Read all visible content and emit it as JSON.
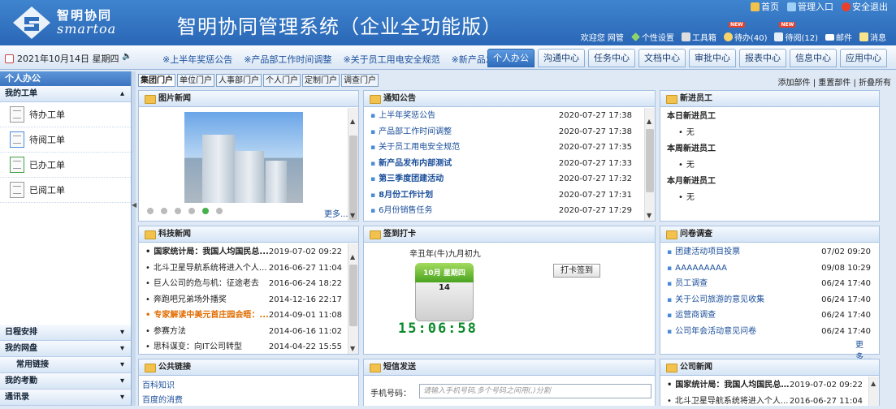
{
  "header": {
    "logo_cn": "智明协同",
    "logo_en": "smartoa",
    "title": "智明协同管理系统（企业全功能版）",
    "toplinks": [
      {
        "label": "首页",
        "icon": "home-icon"
      },
      {
        "label": "管理入口",
        "icon": "admin-icon"
      },
      {
        "label": "安全退出",
        "icon": "power-icon"
      }
    ],
    "userbar": [
      {
        "label": "欢迎您 网管",
        "icon": ""
      },
      {
        "label": "个性设置",
        "icon": "diamond-icon"
      },
      {
        "label": "工具箱",
        "icon": "wrench-icon"
      },
      {
        "label": "待办(40)",
        "icon": "clock-icon",
        "badge": "NEW"
      },
      {
        "label": "待阅(12)",
        "icon": "doc-icon",
        "badge": "NEW"
      },
      {
        "label": "邮件",
        "icon": "mail-icon"
      },
      {
        "label": "消息",
        "icon": "message-icon"
      }
    ]
  },
  "navbar": {
    "date": "2021年10月14日 星期四",
    "marquee": [
      "※上半年奖惩公告",
      "※产品部工作时间调整",
      "※关于员工用电安全规范",
      "※新产品发布内"
    ],
    "tabs": [
      "个人办公",
      "沟通中心",
      "任务中心",
      "文档中心",
      "审批中心",
      "报表中心",
      "信息中心",
      "应用中心"
    ],
    "active_tab": 0
  },
  "sidebar": {
    "head": "个人办公",
    "section": "我的工单",
    "items": [
      "待办工单",
      "待阅工单",
      "已办工单",
      "已阅工单"
    ],
    "bottom": [
      "日程安排",
      "我的网盘",
      "常用链接",
      "我的考勤",
      "通讯录"
    ]
  },
  "subtabs": [
    "集团门户",
    "单位门户",
    "人事部门户",
    "个人门户",
    "定制门户",
    "调查门户"
  ],
  "right_links": "添加部件 | 重置部件 | 折叠所有",
  "panels": {
    "photo_news": {
      "title": "图片新闻",
      "more": "更多..."
    },
    "notice": {
      "title": "通知公告",
      "rows": [
        {
          "t": "上半年奖惩公告",
          "d": "2020-07-27 17:38",
          "style": "blue"
        },
        {
          "t": "产品部工作时间调整",
          "d": "2020-07-27 17:38",
          "style": "blue"
        },
        {
          "t": "关于员工用电安全规范",
          "d": "2020-07-27 17:35",
          "style": "blue"
        },
        {
          "t": "新产品发布内部测试",
          "d": "2020-07-27 17:33",
          "style": "blue bold"
        },
        {
          "t": "第三季度团建活动",
          "d": "2020-07-27 17:32",
          "style": "blue bold"
        },
        {
          "t": "8月份工作计划",
          "d": "2020-07-27 17:31",
          "style": "blue bold"
        },
        {
          "t": "6月份销售任务",
          "d": "2020-07-27 17:29",
          "style": "blue"
        }
      ]
    },
    "new_staff": {
      "title": "新进员工",
      "groups": [
        {
          "head": "本日新进员工",
          "item": "无"
        },
        {
          "head": "本周新进员工",
          "item": "无"
        },
        {
          "head": "本月新进员工",
          "item": "无"
        }
      ]
    },
    "tech_news": {
      "title": "科技新闻",
      "rows": [
        {
          "t": "国家统计局：我国人均国民总...",
          "d": "2019-07-02 09:22",
          "style": "bold"
        },
        {
          "t": "北斗卫星导航系统将进入个人...",
          "d": "2016-06-27 11:04",
          "style": ""
        },
        {
          "t": "巨人公司的危与机：征途老去",
          "d": "2016-06-24 18:22",
          "style": ""
        },
        {
          "t": "奔跑吧兄弟场外播奖",
          "d": "2014-12-16 22:17",
          "style": ""
        },
        {
          "t": "专家解读中美元首庄园会晤：...",
          "d": "2014-09-01 11:08",
          "style": "orange bold"
        },
        {
          "t": "参赛方法",
          "d": "2014-06-16 11:02",
          "style": ""
        },
        {
          "t": "思科谋变：向IT公司转型",
          "d": "2014-04-22 15:55",
          "style": ""
        }
      ]
    },
    "checkin": {
      "title": "签到打卡",
      "lunar": "辛丑年(牛)九月初九",
      "cal_month": "10月 星期四",
      "cal_day": "14",
      "clock": "15:06:58",
      "button": "打卡签到"
    },
    "survey": {
      "title": "问卷调查",
      "more": "更多...",
      "rows": [
        {
          "t": "团建活动项目投票",
          "d": "07/02 09:20"
        },
        {
          "t": "AAAAAAAAA",
          "d": "09/08 10:29"
        },
        {
          "t": "员工调查",
          "d": "06/24 17:40"
        },
        {
          "t": "关于公司旅游的意见收集",
          "d": "06/24 17:40"
        },
        {
          "t": "运营商调查",
          "d": "06/24 17:40"
        },
        {
          "t": "公司年会活动意见问卷",
          "d": "06/24 17:40"
        }
      ]
    },
    "links": {
      "title": "公共链接",
      "rows": [
        "百科知识",
        "百度的消费"
      ]
    },
    "sms": {
      "title": "短信发送",
      "label": "手机号码：",
      "placeholder": "请输入手机号码,多个号码之间用(,)分割"
    },
    "company_news": {
      "title": "公司新闻",
      "rows": [
        {
          "t": "国家统计局：我国人均国民总...",
          "d": "2019-07-02 09:22",
          "style": "bold"
        },
        {
          "t": "北斗卫星导航系统将进入个人...",
          "d": "2016-06-27 11:04",
          "style": ""
        }
      ]
    }
  },
  "colors": {
    "header": "#2f6fbe",
    "accent": "#1a4e9a",
    "active_tab": "#3b7bcb",
    "clock": "#0c8a2b"
  }
}
